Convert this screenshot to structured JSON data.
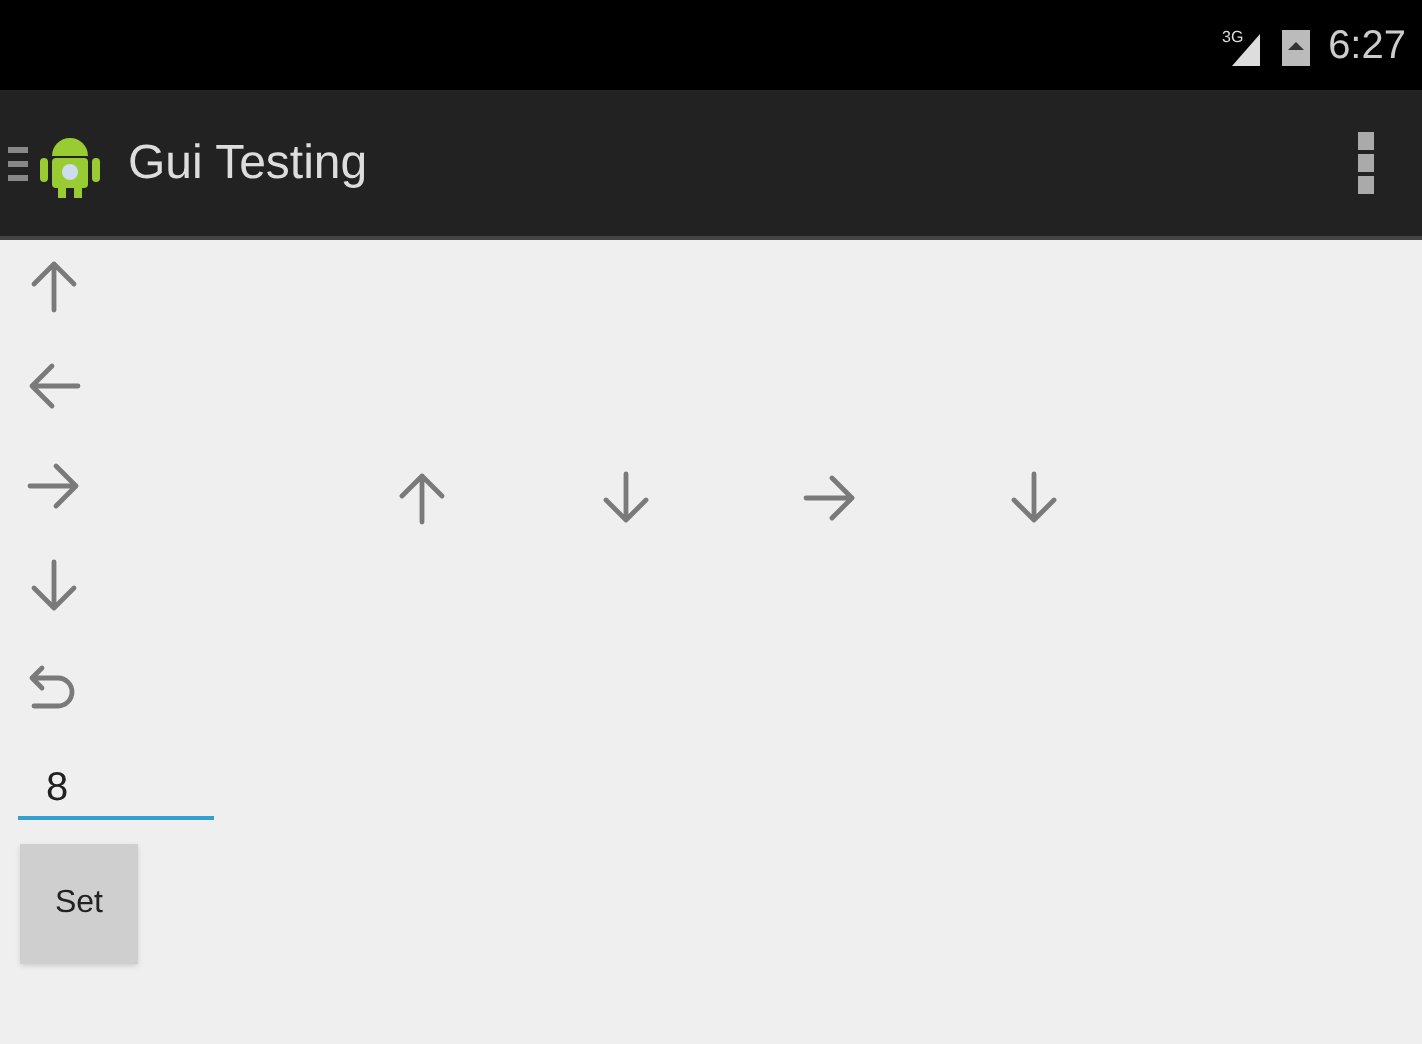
{
  "status_bar": {
    "network": "3G",
    "time": "6:27"
  },
  "action_bar": {
    "title": "Gui Testing"
  },
  "left_buttons": [
    {
      "kind": "up"
    },
    {
      "kind": "left"
    },
    {
      "kind": "right"
    },
    {
      "kind": "down"
    },
    {
      "kind": "undo"
    }
  ],
  "row_buttons": [
    {
      "kind": "up"
    },
    {
      "kind": "down"
    },
    {
      "kind": "right"
    },
    {
      "kind": "down"
    }
  ],
  "input": {
    "value": "8"
  },
  "set_button": {
    "label": "Set"
  }
}
